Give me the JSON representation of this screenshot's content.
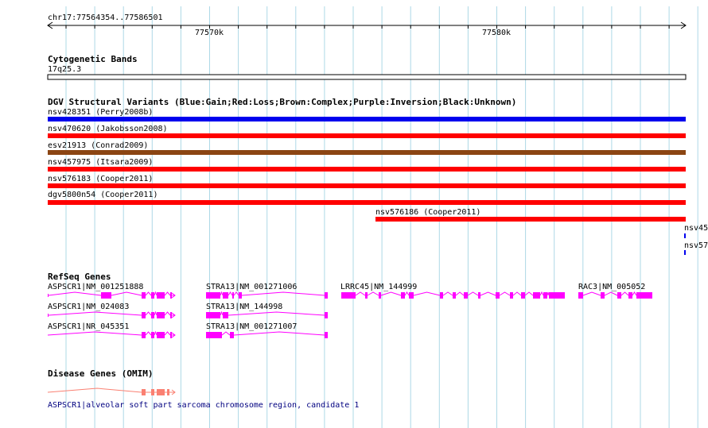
{
  "ruler": {
    "location": "chr17:77564354..77586501",
    "ticks": [
      "77570k",
      "77580k"
    ]
  },
  "cytoband": {
    "title": "Cytogenetic Bands",
    "band": "17q25.3"
  },
  "dgv": {
    "title": "DGV Structural Variants (Blue:Gain;Red:Loss;Brown:Complex;Purple:Inversion;Black:Unknown)",
    "colors": {
      "gain": "#0000ee",
      "loss": "#ff0000",
      "complex": "#8b4513"
    },
    "variants": [
      {
        "label": "nsv428351 (Perry2008b)",
        "type": "gain"
      },
      {
        "label": "nsv470620 (Jakobsson2008)",
        "type": "loss"
      },
      {
        "label": "esv21913 (Conrad2009)",
        "type": "complex"
      },
      {
        "label": "nsv457975 (Itsara2009)",
        "type": "loss"
      },
      {
        "label": "nsv576183 (Cooper2011)",
        "type": "loss"
      },
      {
        "label": "dgv5800n54 (Cooper2011)",
        "type": "loss"
      },
      {
        "label": "nsv576186 (Cooper2011)",
        "type": "loss"
      },
      {
        "label": "nsv45",
        "type": "gain"
      },
      {
        "label": "nsv57",
        "type": "gain"
      }
    ]
  },
  "refseq": {
    "title": "RefSeq Genes",
    "color": "#ff00ff",
    "genes": [
      {
        "label": "ASPSCR1|NM_001251888"
      },
      {
        "label": "ASPSCR1|NM_024083"
      },
      {
        "label": "ASPSCR1|NR_045351"
      },
      {
        "label": "STRA13|NM_001271006"
      },
      {
        "label": "STRA13|NM_144998"
      },
      {
        "label": "STRA13|NM_001271007"
      },
      {
        "label": "LRRC45|NM_144999"
      },
      {
        "label": "RAC3|NM_005052"
      }
    ]
  },
  "omim": {
    "title": "Disease Genes (OMIM)",
    "color": "#fa8072",
    "label": "ASPSCR1|alveolar soft part sarcoma chromosome region, candidate 1"
  },
  "grid_color": "#add8e6"
}
